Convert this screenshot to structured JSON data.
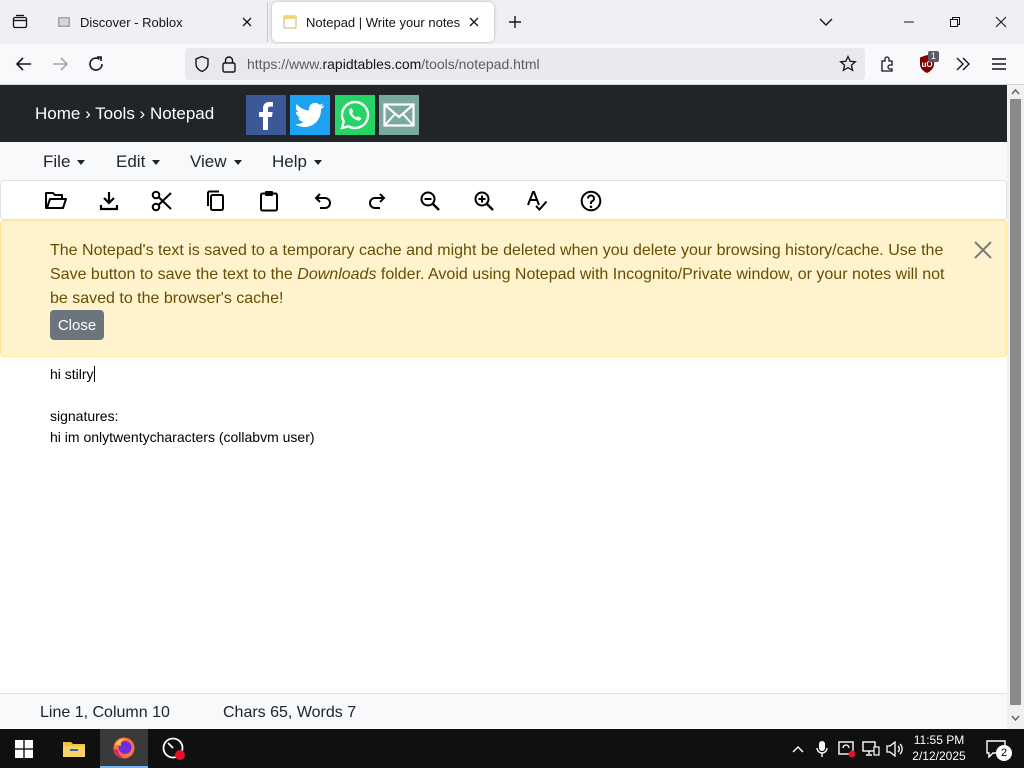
{
  "browser": {
    "tabs": [
      {
        "title": "Discover - Roblox",
        "active": false
      },
      {
        "title": "Notepad | Write your notes online",
        "active": true
      }
    ],
    "url_prefix": "https://www.",
    "url_domain": "rapidtables.com",
    "url_path": "/tools/notepad.html",
    "extension_badge": "1"
  },
  "site": {
    "breadcrumb": "Home › Tools › Notepad",
    "share_icons": [
      "facebook-icon",
      "twitter-icon",
      "whatsapp-icon",
      "email-icon"
    ]
  },
  "menu": {
    "items": [
      {
        "label": "File"
      },
      {
        "label": "Edit"
      },
      {
        "label": "View"
      },
      {
        "label": "Help"
      }
    ]
  },
  "toolbar": {
    "tools": [
      "open-icon",
      "download-icon",
      "cut-icon",
      "copy-icon",
      "paste-icon",
      "undo-icon",
      "redo-icon",
      "zoom-out-icon",
      "zoom-in-icon",
      "spellcheck-icon",
      "help-icon"
    ]
  },
  "alert": {
    "text_1": "The Notepad's text is saved to a temporary cache and might be deleted when you delete your browsing history/cache. Use the Save button to save the text to the ",
    "text_em": "Downloads",
    "text_2": " folder. Avoid using Notepad with Incognito/Private window, or your notes will not be saved to the browser's cache!",
    "close_label": "Close"
  },
  "editor": {
    "line_1": "hi stilry",
    "line_2": "",
    "line_3": "signatures:",
    "line_4": "hi im onlytwentycharacters (collabvm user)"
  },
  "status": {
    "position": "Line 1, Column 10",
    "counts": "Chars 65, Words 7"
  },
  "taskbar": {
    "time": "11:55 PM",
    "date": "2/12/2025",
    "notification_count": "2"
  },
  "colors": {
    "header_bg": "#212529",
    "alert_bg": "#fff3cd",
    "alert_text": "#664d03",
    "close_btn": "#6c757d",
    "facebook": "#3b5998",
    "twitter": "#1da1f2",
    "whatsapp": "#25d366",
    "email": "#7ba89c"
  }
}
